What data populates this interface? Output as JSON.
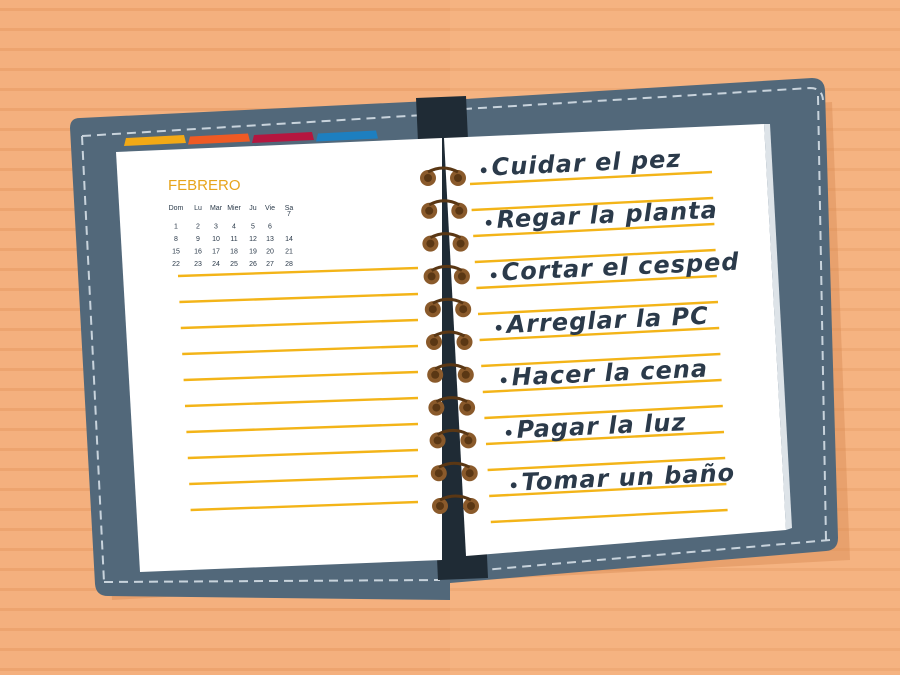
{
  "colors": {
    "table_wood": "#f4b07e",
    "wood_stripe": "#e89a63",
    "cover": "#52687a",
    "cover_edge": "#3b4c5a",
    "stitch": "#c8d3dc",
    "binding": "#1f2b35",
    "paper": "#ffffff",
    "paper_shadow": "#dde3e8",
    "rule_line": "#f3b418",
    "ring": "#8a5a2b",
    "ring_dark": "#5a3714",
    "text_dark": "#2b3a4a",
    "month_color": "#e7a51c",
    "tab_colors": [
      "#f2a915",
      "#ef5a24",
      "#b5163f",
      "#1d7fc0"
    ]
  },
  "calendar": {
    "month": "FEBRERO",
    "weekdays": [
      "Dom",
      "Lu",
      "Mar",
      "Mier",
      "Ju",
      "Vie",
      "Sa"
    ],
    "weeks": [
      [
        "",
        "",
        "",
        "",
        "",
        "",
        "7"
      ],
      [
        "1",
        "2",
        "3",
        "4",
        "5",
        "6",
        ""
      ],
      [
        "8",
        "9",
        "10",
        "11",
        "12",
        "13",
        "14"
      ],
      [
        "15",
        "16",
        "17",
        "18",
        "19",
        "20",
        "21"
      ],
      [
        "22",
        "23",
        "24",
        "25",
        "26",
        "27",
        "28"
      ]
    ]
  },
  "todo": {
    "bullet": "•",
    "items": [
      "Cuidar el pez",
      "Regar la planta",
      "Cortar el cesped",
      "Arreglar la PC",
      "Hacer la cena",
      "Pagar la luz",
      "Tomar un baño"
    ]
  }
}
